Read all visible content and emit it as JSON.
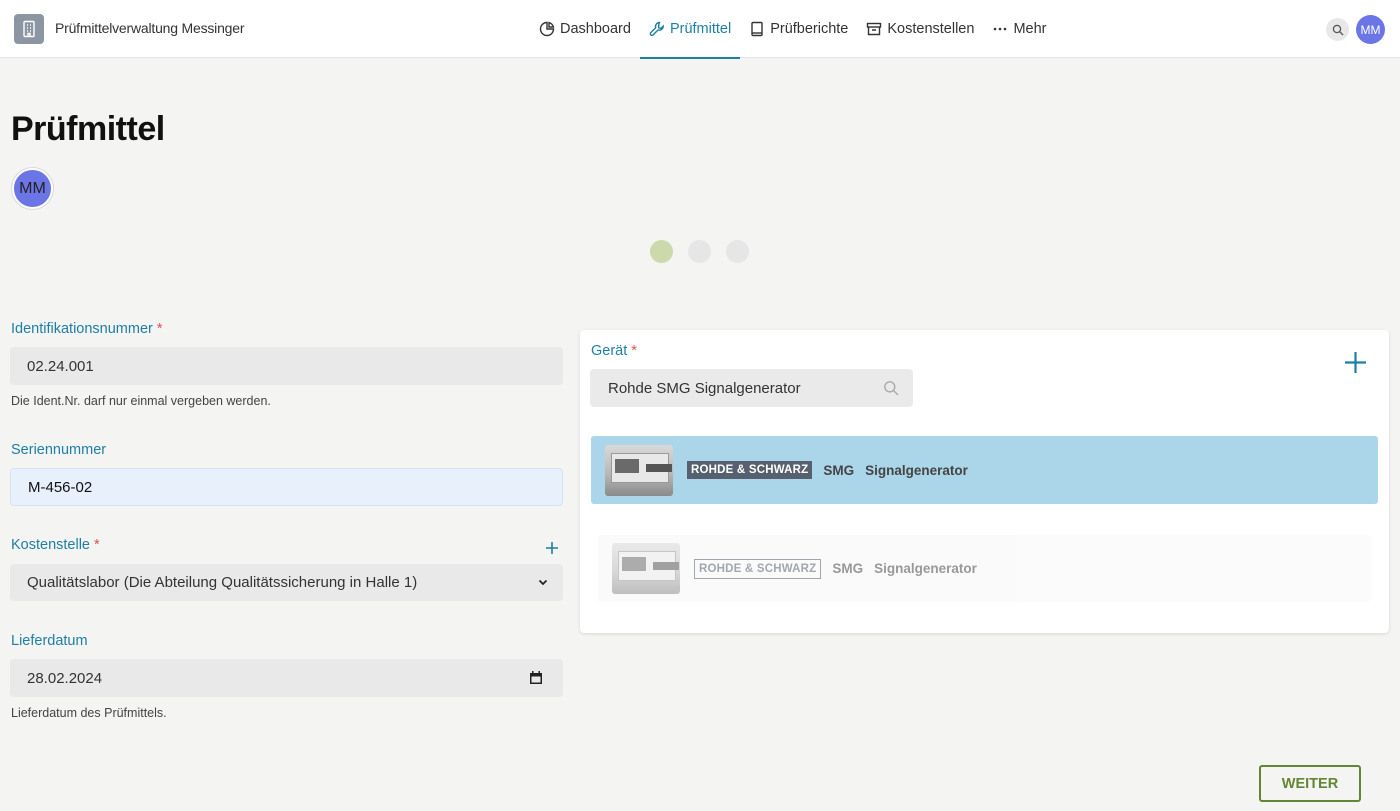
{
  "app": {
    "title": "Prüfmittelverwaltung Messinger",
    "logo_icon": "building-icon"
  },
  "nav": {
    "items": [
      {
        "label": "Dashboard",
        "icon": "pie-chart-icon",
        "active": false
      },
      {
        "label": "Prüfmittel",
        "icon": "wrench-icon",
        "active": true
      },
      {
        "label": "Prüfberichte",
        "icon": "book-icon",
        "active": false
      },
      {
        "label": "Kostenstellen",
        "icon": "archive-icon",
        "active": false
      },
      {
        "label": "Mehr",
        "icon": "more-dots-icon",
        "active": false
      }
    ]
  },
  "header": {
    "user_initials": "MM"
  },
  "page": {
    "title": "Prüfmittel",
    "owner_initials": "MM"
  },
  "stepper": {
    "total": 3,
    "current": 1
  },
  "form": {
    "ident": {
      "label": "Identifikationsnummer",
      "required": "*",
      "value": "02.24.001",
      "hint": "Die Ident.Nr. darf nur einmal vergeben werden."
    },
    "serial": {
      "label": "Seriennummer",
      "value": "M-456-02"
    },
    "cost_center": {
      "label": "Kostenstelle",
      "required": "*",
      "value": "Qualitätslabor (Die Abteilung Qualitätssicherung in Halle 1)"
    },
    "delivery": {
      "label": "Lieferdatum",
      "value": "28.02.2024",
      "hint": "Lieferdatum des Prüfmittels."
    }
  },
  "device_panel": {
    "label": "Gerät",
    "required": "*",
    "search_value": "Rohde SMG Signalgenerator",
    "results": [
      {
        "brand": "ROHDE & SCHWARZ",
        "model": "SMG",
        "type": "Signalgenerator",
        "selected": true
      },
      {
        "brand": "ROHDE & SCHWARZ",
        "model": "SMG",
        "type": "Signalgenerator",
        "selected": false
      }
    ]
  },
  "actions": {
    "next_label": "WEITER"
  },
  "colors": {
    "accent": "#1d7fa6",
    "selected_row": "#abd6e9",
    "next_button": "#628634",
    "avatar": "#6c75e6",
    "required": "#d9534f"
  }
}
